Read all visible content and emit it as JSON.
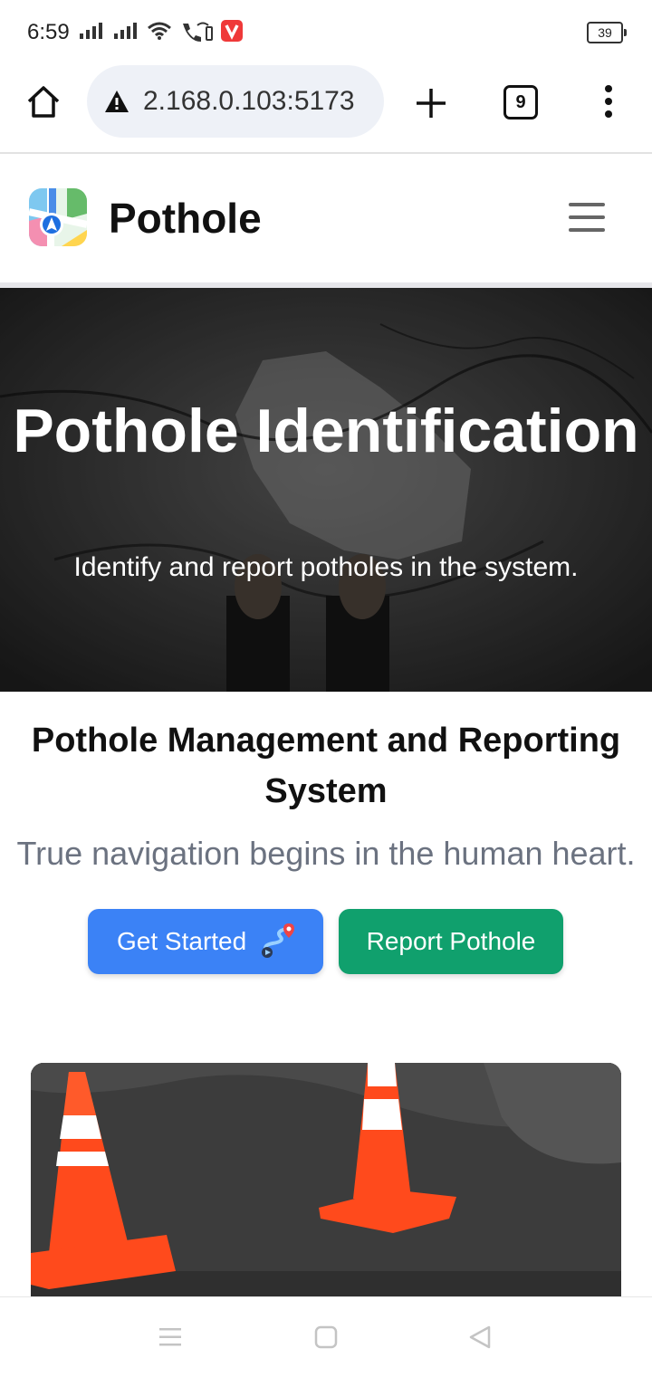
{
  "status_bar": {
    "time": "6:59",
    "battery": "39",
    "icons": [
      "signal-icon",
      "signal-icon",
      "wifi-icon",
      "wifi-call-icon",
      "vivaldi-icon"
    ]
  },
  "browser": {
    "url": "2.168.0.103:5173",
    "tab_count": "9",
    "icons": [
      "home-icon",
      "not-secure-warning-icon",
      "new-tab-plus-icon",
      "more-vert-icon"
    ]
  },
  "navbar": {
    "brand": "Pothole",
    "logo_icon": "maps-logo-icon",
    "menu_icon": "hamburger-menu-icon"
  },
  "hero": {
    "title": "Pothole Identification",
    "subtitle": "Identify and report potholes in the system."
  },
  "main": {
    "section_title": "Pothole Management and Reporting System",
    "tagline": "True navigation begins in the human heart.",
    "get_started_label": "Get Started",
    "report_label": "Report Pothole"
  },
  "colors": {
    "primary_button": "#3b82f6",
    "report_button": "#10a06d",
    "tagline_text": "#6b7280"
  },
  "system_nav": {
    "icons": [
      "recents-icon",
      "home-square-icon",
      "back-triangle-icon"
    ]
  }
}
